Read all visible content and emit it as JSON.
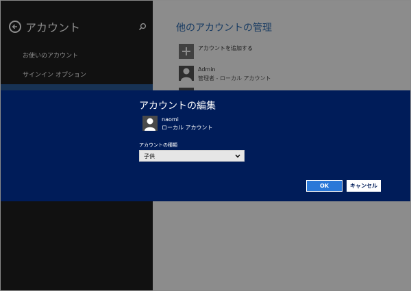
{
  "left_pane": {
    "title": "アカウント",
    "nav_items": [
      "お使いのアカウント",
      "サインイン オプション"
    ]
  },
  "right_pane": {
    "title": "他のアカウントの管理",
    "add_account_label": "アカウントを追加する",
    "accounts": [
      {
        "name": "Admin",
        "type": "管理者 - ローカル アカウント"
      }
    ]
  },
  "dialog": {
    "title": "アカウントの編集",
    "user_name": "naomi",
    "user_type": "ローカル アカウント",
    "account_type_label": "アカウントの種類",
    "account_type_value": "子供",
    "ok_label": "OK",
    "cancel_label": "キャンセル"
  },
  "colors": {
    "dialog_background": "#001c59",
    "ok_button": "#2a78d8",
    "accent_title": "#2d6cb2"
  },
  "icons": {
    "back": "back-arrow-icon",
    "search": "search-icon",
    "add": "plus-icon",
    "avatar": "person-icon",
    "dropdown": "chevron-down-icon"
  }
}
